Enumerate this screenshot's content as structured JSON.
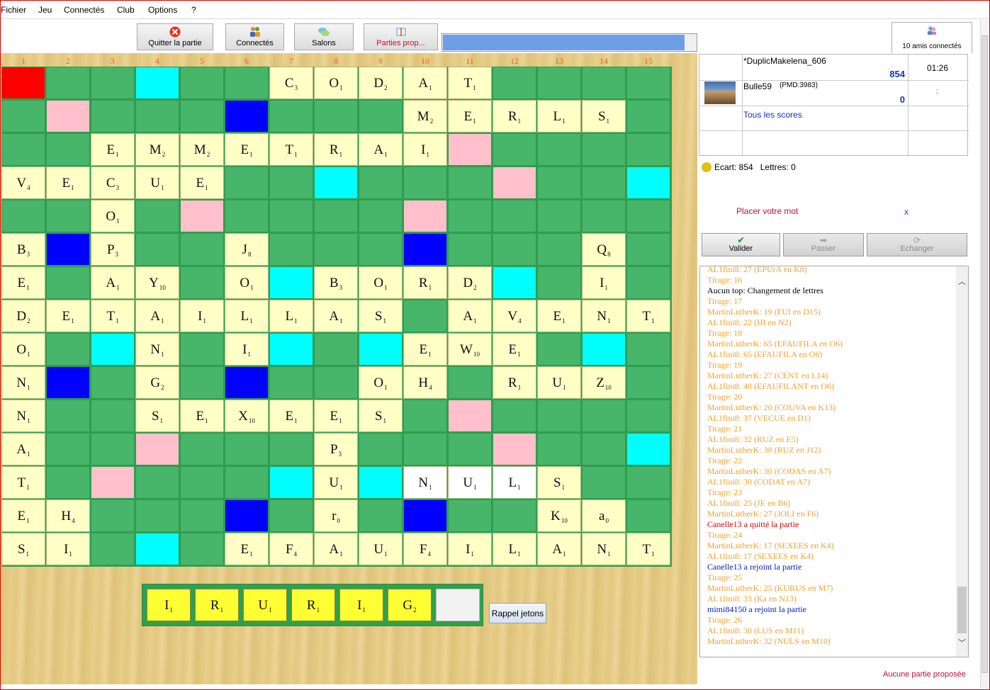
{
  "menu": [
    "Fichier",
    "Jeu",
    "Connectés",
    "Club",
    "Options",
    "?"
  ],
  "toolbar": {
    "quit_label": "Quitter la partie",
    "connected_label": "Connectés",
    "rooms_label": "Salons",
    "proposed_label": "Parties prop...",
    "progress_fraction": 0.955,
    "friends_label": "10 amis connectés"
  },
  "board": {
    "columns": [
      "1",
      "2",
      "3",
      "4",
      "5",
      "6",
      "7",
      "8",
      "9",
      "10",
      "11",
      "12",
      "13",
      "14",
      "15"
    ],
    "premium_rows": [
      "T..D...........",
      ".P...L.........",
      "..........P....",
      ".......D...P..D",
      "....P....P.....",
      ".L.......L.....",
      "......D....D...",
      "...............",
      "..D...D.D....D.",
      ".L...L.........",
      "..........P....",
      "...P.......P..D",
      "..P...D.D......",
      ".....L...L.....",
      "...D..........."
    ],
    "tiles": [
      [
        [
          6,
          "C",
          "3"
        ],
        [
          7,
          "O",
          "1"
        ],
        [
          8,
          "D",
          "2"
        ],
        [
          9,
          "A",
          "1"
        ],
        [
          10,
          "T",
          "1"
        ]
      ],
      [
        [
          9,
          "M",
          "2"
        ],
        [
          10,
          "E",
          "1"
        ],
        [
          11,
          "R",
          "1"
        ],
        [
          12,
          "L",
          "1"
        ],
        [
          13,
          "S",
          "1"
        ]
      ],
      [
        [
          2,
          "E",
          "1"
        ],
        [
          3,
          "M",
          "2"
        ],
        [
          4,
          "M",
          "2"
        ],
        [
          5,
          "E",
          "1"
        ],
        [
          6,
          "T",
          "1"
        ],
        [
          7,
          "R",
          "1"
        ],
        [
          8,
          "A",
          "1"
        ],
        [
          9,
          "I",
          "1"
        ]
      ],
      [
        [
          0,
          "V",
          "4"
        ],
        [
          1,
          "E",
          "1"
        ],
        [
          2,
          "C",
          "3"
        ],
        [
          3,
          "U",
          "1"
        ],
        [
          4,
          "E",
          "1"
        ]
      ],
      [
        [
          2,
          "O",
          "1"
        ]
      ],
      [
        [
          0,
          "B",
          "3"
        ],
        [
          2,
          "P",
          "3"
        ],
        [
          5,
          "J",
          "8"
        ],
        [
          13,
          "Q",
          "8"
        ]
      ],
      [
        [
          0,
          "E",
          "1"
        ],
        [
          2,
          "A",
          "1"
        ],
        [
          3,
          "Y",
          "10"
        ],
        [
          5,
          "O",
          "1"
        ],
        [
          7,
          "B",
          "3"
        ],
        [
          8,
          "O",
          "1"
        ],
        [
          9,
          "R",
          "1"
        ],
        [
          10,
          "D",
          "2"
        ],
        [
          13,
          "I",
          "1"
        ]
      ],
      [
        [
          0,
          "D",
          "2"
        ],
        [
          1,
          "E",
          "1"
        ],
        [
          2,
          "T",
          "1"
        ],
        [
          3,
          "A",
          "1"
        ],
        [
          4,
          "I",
          "1"
        ],
        [
          5,
          "L",
          "1"
        ],
        [
          6,
          "L",
          "1"
        ],
        [
          7,
          "A",
          "1"
        ],
        [
          8,
          "S",
          "1"
        ],
        [
          10,
          "A",
          "1"
        ],
        [
          11,
          "V",
          "4"
        ],
        [
          12,
          "E",
          "1"
        ],
        [
          13,
          "N",
          "1"
        ],
        [
          14,
          "T",
          "1"
        ]
      ],
      [
        [
          0,
          "O",
          "1"
        ],
        [
          3,
          "N",
          "1"
        ],
        [
          5,
          "I",
          "1"
        ],
        [
          9,
          "E",
          "1"
        ],
        [
          10,
          "W",
          "10"
        ],
        [
          11,
          "E",
          "1"
        ]
      ],
      [
        [
          0,
          "N",
          "1"
        ],
        [
          3,
          "G",
          "2"
        ],
        [
          8,
          "O",
          "1"
        ],
        [
          9,
          "H",
          "4"
        ],
        [
          11,
          "R",
          "1"
        ],
        [
          12,
          "U",
          "1"
        ],
        [
          13,
          "Z",
          "10"
        ]
      ],
      [
        [
          0,
          "N",
          "1"
        ],
        [
          3,
          "S",
          "1"
        ],
        [
          4,
          "E",
          "1"
        ],
        [
          5,
          "X",
          "10"
        ],
        [
          6,
          "E",
          "1"
        ],
        [
          7,
          "E",
          "1"
        ],
        [
          8,
          "S",
          "1"
        ]
      ],
      [
        [
          0,
          "A",
          "1"
        ],
        [
          7,
          "P",
          "3"
        ]
      ],
      [
        [
          0,
          "T",
          "1"
        ],
        [
          7,
          "U",
          "1"
        ],
        [
          9,
          "N",
          "1",
          "new"
        ],
        [
          10,
          "U",
          "1",
          "new"
        ],
        [
          11,
          "L",
          "1",
          "new"
        ],
        [
          12,
          "S",
          "1"
        ]
      ],
      [
        [
          0,
          "E",
          "1"
        ],
        [
          1,
          "H",
          "4"
        ],
        [
          7,
          "r",
          "0"
        ],
        [
          12,
          "K",
          "10"
        ],
        [
          13,
          "a",
          "0"
        ]
      ],
      [
        [
          0,
          "S",
          "1"
        ],
        [
          1,
          "I",
          "1"
        ],
        [
          5,
          "E",
          "1"
        ],
        [
          6,
          "F",
          "4"
        ],
        [
          7,
          "A",
          "1"
        ],
        [
          8,
          "U",
          "1"
        ],
        [
          9,
          "F",
          "4"
        ],
        [
          10,
          "I",
          "1"
        ],
        [
          11,
          "L",
          "1"
        ],
        [
          12,
          "A",
          "1"
        ],
        [
          13,
          "N",
          "1"
        ],
        [
          14,
          "T",
          "1"
        ]
      ]
    ]
  },
  "rack": {
    "tiles": [
      [
        "I",
        "1"
      ],
      [
        "R",
        "1"
      ],
      [
        "U",
        "1"
      ],
      [
        "R",
        "1"
      ],
      [
        "I",
        "1"
      ],
      [
        "G",
        "2"
      ],
      [
        "",
        ""
      ]
    ],
    "recall_label": "Rappel jetons"
  },
  "scores": {
    "player1_name": "*DuplicMakelena_606",
    "player1_score": "854",
    "timer": "01:26",
    "player2_name": "Bulle59",
    "player2_pmd": "(PMD:3983)",
    "player2_score": "0",
    "player2_time": ":",
    "all_scores_link": "Tous les scores"
  },
  "status": {
    "ecart": "Ecart: 854",
    "lettres": "Lettres: 0"
  },
  "placement": {
    "prompt": "Placer votre mot",
    "close": "x"
  },
  "actions": {
    "validate": "Valider",
    "pass": "Passer",
    "exchange": "Echanger"
  },
  "log": [
    [
      "o",
      "AL1fini8: 27 (EPUrA en K8)"
    ],
    [
      "o",
      "Tirage: 16"
    ],
    [
      "s",
      "Aucun top: Changement de lettres"
    ],
    [
      "o",
      "Tirage: 17"
    ],
    [
      "o",
      "MartinLutherK: 19 (FUI en D15)"
    ],
    [
      "o",
      "AL1fini8: 22 (HI en N2)"
    ],
    [
      "o",
      "Tirage: 18"
    ],
    [
      "o",
      "MartinLutherK: 65 (EFAUFILA en O6)"
    ],
    [
      "o",
      "AL1fini8: 65 (EFAUFILA en O6)"
    ],
    [
      "o",
      "Tirage: 19"
    ],
    [
      "o",
      "MartinLutherK: 27 (CENT en L14)"
    ],
    [
      "o",
      "AL1fini8: 48 (EFAUFILANT en O6)"
    ],
    [
      "o",
      "Tirage: 20"
    ],
    [
      "o",
      "MartinLutherK: 20 (COUVA en K13)"
    ],
    [
      "o",
      "AL1fini8: 37 (VECUE en D1)"
    ],
    [
      "o",
      "Tirage: 21"
    ],
    [
      "o",
      "AL1fini8: 32 (RUZ en E5)"
    ],
    [
      "o",
      "MartinLutherK: 38 (RUZ en J12)"
    ],
    [
      "o",
      "Tirage: 22"
    ],
    [
      "o",
      "MartinLutherK: 30 (CODAS en A7)"
    ],
    [
      "o",
      "AL1fini8: 30 (CODAT en A7)"
    ],
    [
      "o",
      "Tirage: 23"
    ],
    [
      "o",
      "AL1fini8: 25 (JE en B6)"
    ],
    [
      "o",
      "MartinLutherK: 27 (JOLI en F6)"
    ],
    [
      "r",
      "Canelle13 a quitté la partie"
    ],
    [
      "o",
      "Tirage: 24"
    ],
    [
      "o",
      "MartinLutherK: 17 (SEXEES en K4)"
    ],
    [
      "o",
      "AL1fini8: 17 (SEXEES en K4)"
    ],
    [
      "b",
      "Canelle13 a rejoint la partie"
    ],
    [
      "o",
      "Tirage: 25"
    ],
    [
      "o",
      "MartinLutherK: 25 (KURUS en M7)"
    ],
    [
      "o",
      "AL1fini8: 33 (Ka en N13)"
    ],
    [
      "b",
      "mimi84150 a rejoint la partie"
    ],
    [
      "o",
      "Tirage: 26"
    ],
    [
      "o",
      "AL1fini8: 30 (LUS en M11)"
    ],
    [
      "o",
      "MartinLutherK: 32 (NULS en M10)"
    ]
  ],
  "footer": {
    "no_game": "Aucune partie proposée"
  }
}
